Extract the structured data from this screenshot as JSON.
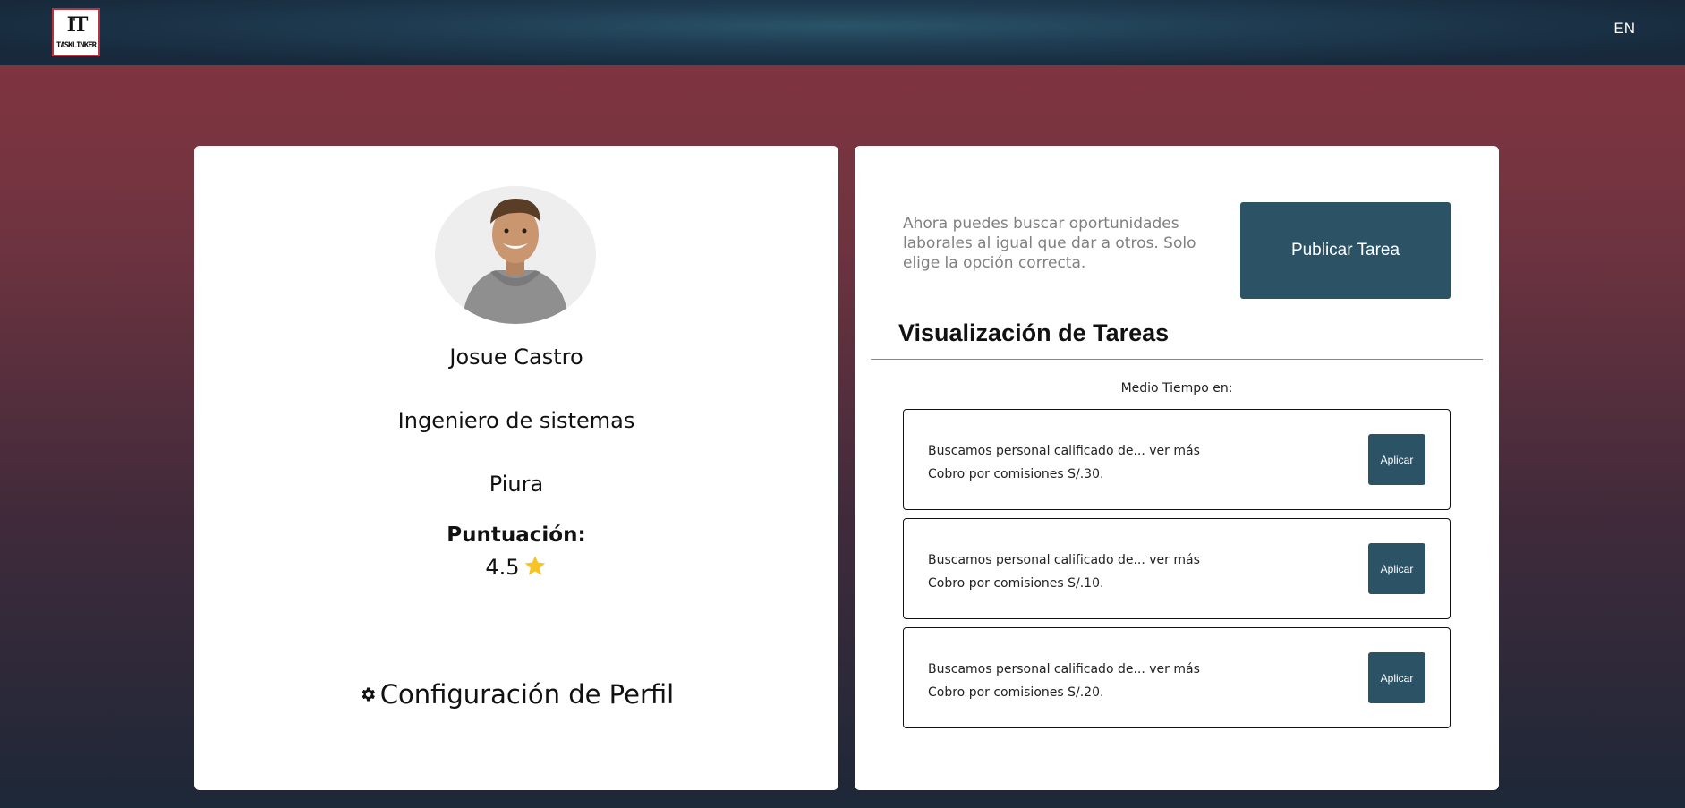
{
  "header": {
    "logo_mark": "IT",
    "logo_word": "TASKLINKER",
    "language": "EN"
  },
  "profile": {
    "name": "Josue Castro",
    "job": "Ingeniero de sistemas",
    "city": "Piura",
    "score_label": "Puntuación:",
    "score_value": "4.5",
    "settings_label": "Configuración de Perfil",
    "star_color": "#f7c325"
  },
  "tasks_panel": {
    "intro": "Ahora puedes buscar oportunidades laborales al igual que dar a otros. Solo elige la opción correcta.",
    "publish_label": "Publicar Tarea",
    "title": "Visualización de Tareas",
    "subtitle": "Medio Tiempo en:",
    "items": [
      {
        "description": "Buscamos personal calificado de...",
        "more": "ver más",
        "pay": "Cobro por comisiones S/.30.",
        "apply_label": "Aplicar"
      },
      {
        "description": "Buscamos personal calificado de...",
        "more": "ver más",
        "pay": "Cobro por comisiones S/.10.",
        "apply_label": "Aplicar"
      },
      {
        "description": "Buscamos personal calificado de...",
        "more": "ver más",
        "pay": "Cobro por comisiones S/.20.",
        "apply_label": "Aplicar"
      }
    ]
  },
  "colors": {
    "accent_button": "#2c5365",
    "header_dark": "#17293b",
    "background_top": "#863540",
    "background_bottom": "#1d2838"
  }
}
